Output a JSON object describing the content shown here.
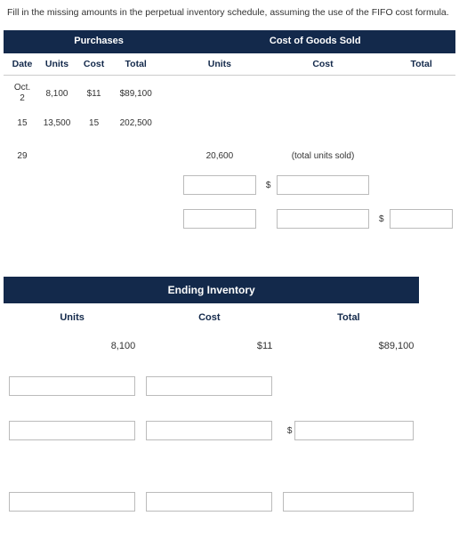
{
  "instructions": "Fill in the missing amounts in the perpetual inventory schedule, assuming the use of the FIFO cost formula.",
  "top": {
    "groupHeaders": {
      "purchases": "Purchases",
      "cogs": "Cost of Goods Sold"
    },
    "colHeaders": {
      "date": "Date",
      "units": "Units",
      "cost": "Cost",
      "total": "Total"
    },
    "rows": [
      {
        "date": "Oct. 2",
        "pUnits": "8,100",
        "pCost": "$11",
        "pTotal": "$89,100"
      },
      {
        "date": "15",
        "pUnits": "13,500",
        "pCost": "15",
        "pTotal": "202,500"
      }
    ],
    "row29": {
      "date": "29",
      "cogsUnits": "20,600",
      "cogsCostNote": "(total units sold)"
    },
    "currency": "$"
  },
  "ending": {
    "title": "Ending Inventory",
    "cols": {
      "units": "Units",
      "cost": "Cost",
      "total": "Total"
    },
    "row1": {
      "units": "8,100",
      "cost": "$11",
      "total": "$89,100"
    },
    "currency": "$"
  }
}
